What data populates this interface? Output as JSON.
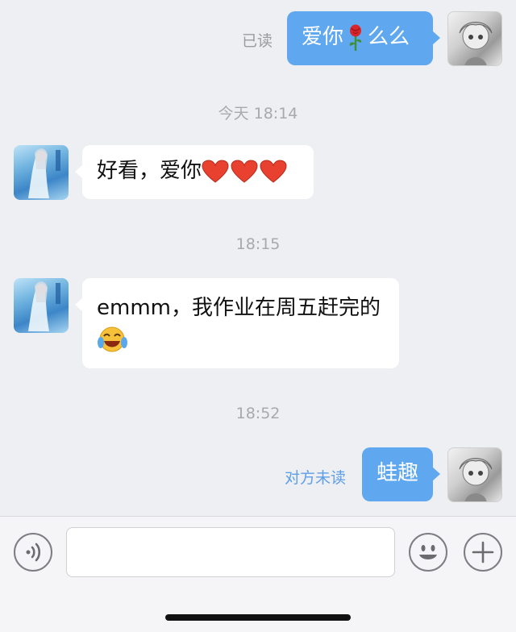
{
  "messages": [
    {
      "side": "out",
      "text_parts": [
        "爱你",
        "么么"
      ],
      "inline_icon": "rose-emoji",
      "status": "已读"
    },
    {
      "timestamp": "今天 18:14"
    },
    {
      "side": "in",
      "text": "好看，爱你",
      "trailing_icons": [
        "heart-emoji",
        "heart-emoji",
        "heart-emoji"
      ]
    },
    {
      "timestamp": "18:15"
    },
    {
      "side": "in",
      "text": "emmm，我作业在周五赶完的",
      "trailing_icon": "laugh-cry-emoji"
    },
    {
      "timestamp": "18:52"
    },
    {
      "side": "out",
      "text": "蛙趣",
      "status": "对方未读"
    }
  ],
  "input_bar": {
    "voice_icon": "voice-icon",
    "emoji_icon": "smiley-icon",
    "plus_icon": "plus-icon",
    "placeholder": ""
  },
  "colors": {
    "outgoing_bubble": "#5fa8f0",
    "incoming_bubble": "#ffffff",
    "background": "#eeeff3",
    "unread_status": "#5d9ee8"
  }
}
